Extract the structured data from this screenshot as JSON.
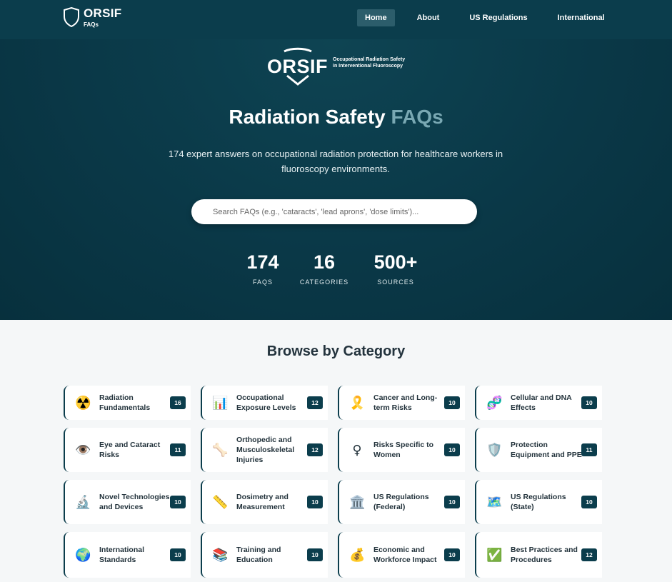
{
  "nav": {
    "brand_title": "ORSIF",
    "brand_sub": "FAQs",
    "links": [
      {
        "label": "Home",
        "active": true
      },
      {
        "label": "About",
        "active": false
      },
      {
        "label": "US Regulations",
        "active": false
      },
      {
        "label": "International",
        "active": false
      }
    ]
  },
  "hero": {
    "logo_word": "ORSIF",
    "logo_text_line1": "Occupational Radiation Safety",
    "logo_text_line2": "in Interventional Fluoroscopy",
    "title_main": "Radiation Safety",
    "title_accent": "FAQs",
    "description": "174 expert answers on occupational radiation protection for healthcare workers in fluoroscopy environments.",
    "search_placeholder": "Search FAQs (e.g., 'cataracts', 'lead aprons', 'dose limits')...",
    "stats": [
      {
        "value": "174",
        "label": "FAQS"
      },
      {
        "value": "16",
        "label": "CATEGORIES"
      },
      {
        "value": "500+",
        "label": "SOURCES"
      }
    ]
  },
  "browse": {
    "title": "Browse by Category",
    "categories": [
      {
        "label": "Radiation Fundamentals",
        "count": "16",
        "icon": "☢️",
        "icon_name": "radioactive-icon"
      },
      {
        "label": "Occupational Exposure Levels",
        "count": "12",
        "icon": "📊",
        "icon_name": "bar-chart-icon"
      },
      {
        "label": "Cancer and Long-term Risks",
        "count": "10",
        "icon": "🎗️",
        "icon_name": "ribbon-icon"
      },
      {
        "label": "Cellular and DNA Effects",
        "count": "10",
        "icon": "🧬",
        "icon_name": "dna-icon"
      },
      {
        "label": "Eye and Cataract Risks",
        "count": "11",
        "icon": "👁️",
        "icon_name": "eye-icon"
      },
      {
        "label": "Orthopedic and Musculoskeletal Injuries",
        "count": "12",
        "icon": "🦴",
        "icon_name": "bone-icon"
      },
      {
        "label": "Risks Specific to Women",
        "count": "10",
        "icon": "♀",
        "icon_name": "female-symbol-icon"
      },
      {
        "label": "Protection Equipment and PPE",
        "count": "11",
        "icon": "🛡️",
        "icon_name": "shield-icon"
      },
      {
        "label": "Novel Technologies and Devices",
        "count": "10",
        "icon": "🔬",
        "icon_name": "microscope-icon"
      },
      {
        "label": "Dosimetry and Measurement",
        "count": "10",
        "icon": "📏",
        "icon_name": "ruler-icon"
      },
      {
        "label": "US Regulations (Federal)",
        "count": "10",
        "icon": "🏛️",
        "icon_name": "government-building-icon"
      },
      {
        "label": "US Regulations (State)",
        "count": "10",
        "icon": "🗺️",
        "icon_name": "map-icon"
      },
      {
        "label": "International Standards",
        "count": "10",
        "icon": "🌍",
        "icon_name": "globe-icon"
      },
      {
        "label": "Training and Education",
        "count": "10",
        "icon": "📚",
        "icon_name": "books-icon"
      },
      {
        "label": "Economic and Workforce Impact",
        "count": "10",
        "icon": "💰",
        "icon_name": "money-bag-icon"
      },
      {
        "label": "Best Practices and Procedures",
        "count": "12",
        "icon": "✅",
        "icon_name": "check-mark-icon"
      }
    ]
  }
}
